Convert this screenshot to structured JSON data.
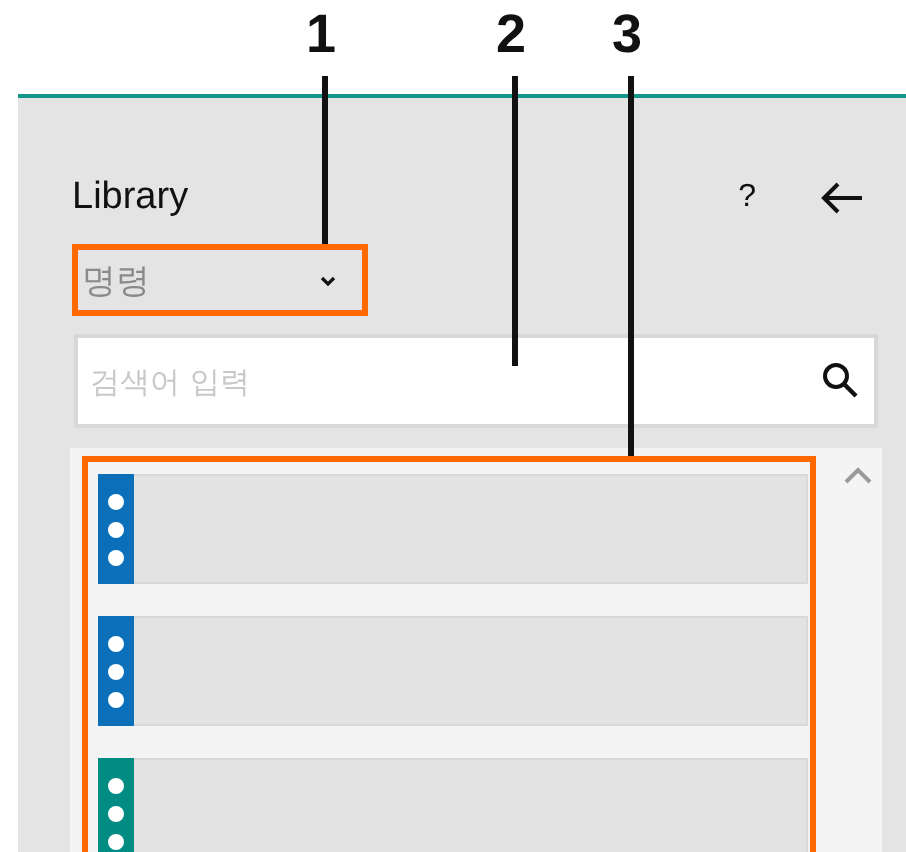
{
  "callouts": [
    {
      "label": "1"
    },
    {
      "label": "2"
    },
    {
      "label": "3"
    }
  ],
  "panel": {
    "title": "Library",
    "help": "?",
    "dropdown": {
      "value": "명령"
    },
    "search": {
      "placeholder": "검색어 입력"
    },
    "items": [
      {
        "color": "#0b6fba"
      },
      {
        "color": "#0b6fba"
      },
      {
        "color": "#008c82"
      }
    ]
  }
}
